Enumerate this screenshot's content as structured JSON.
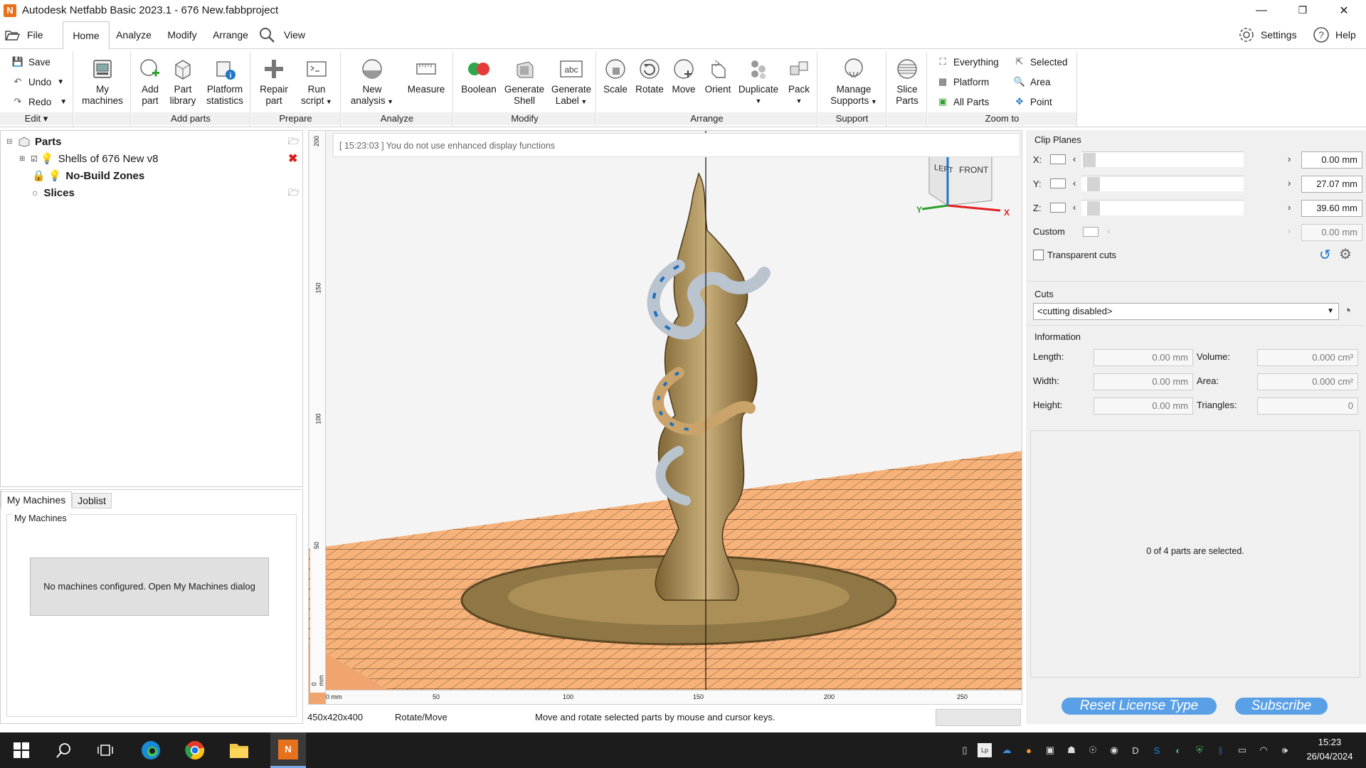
{
  "window": {
    "title": "Autodesk Netfabb Basic 2023.1 - 676 New.fabbproject",
    "app_icon_letter": "N",
    "minimize": "—",
    "restore": "❐",
    "close": "✕"
  },
  "menubar": {
    "file": "File",
    "tabs": [
      "Home",
      "Analyze",
      "Modify",
      "Arrange"
    ],
    "view": "View",
    "settings": "Settings",
    "help": "Help"
  },
  "ribbon": {
    "edit": {
      "save": "Save",
      "undo": "Undo",
      "redo": "Redo",
      "label": "Edit"
    },
    "my_machines": {
      "l1": "My",
      "l2": "machines"
    },
    "add_parts": {
      "add_part": {
        "l1": "Add",
        "l2": "part"
      },
      "part_library": {
        "l1": "Part",
        "l2": "library"
      },
      "platform_statistics": {
        "l1": "Platform",
        "l2": "statistics"
      },
      "label": "Add parts"
    },
    "prepare": {
      "repair_part": {
        "l1": "Repair",
        "l2": "part"
      },
      "run_script": {
        "l1": "Run",
        "l2": "script"
      },
      "label": "Prepare"
    },
    "analyze": {
      "new_analysis": {
        "l1": "New",
        "l2": "analysis"
      },
      "measure": "Measure",
      "label": "Analyze"
    },
    "modify": {
      "boolean": "Boolean",
      "generate_shell": {
        "l1": "Generate",
        "l2": "Shell"
      },
      "generate_label": {
        "l1": "Generate",
        "l2": "Label"
      },
      "label": "Modify"
    },
    "arrange": {
      "scale": "Scale",
      "rotate": "Rotate",
      "move": "Move",
      "orient": "Orient",
      "duplicate": "Duplicate",
      "pack": "Pack",
      "label": "Arrange"
    },
    "support": {
      "manage_supports": {
        "l1": "Manage",
        "l2": "Supports"
      },
      "label": "Support"
    },
    "slice": {
      "l1": "Slice",
      "l2": "Parts"
    },
    "zoom": {
      "everything": "Everything",
      "platform": "Platform",
      "all_parts": "All Parts",
      "selected": "Selected",
      "area": "Area",
      "point": "Point",
      "label": "Zoom to"
    }
  },
  "tree": {
    "parts": "Parts",
    "shells": "Shells of 676 New v8",
    "no_build": "No-Build Zones",
    "slices": "Slices"
  },
  "machines_panel": {
    "tabs": [
      "My Machines",
      "Joblist"
    ],
    "group": "My Machines",
    "message": "No machines configured. Open My Machines dialog"
  },
  "viewport": {
    "log": "[ 15:23:03 ] You do not use enhanced display functions",
    "cube_left": "LEFT",
    "cube_front": "FRONT",
    "axis_x": "X",
    "axis_y": "Y",
    "vruler": [
      "200",
      "150",
      "100",
      "50",
      "0 mm"
    ],
    "hruler": [
      "0 mm",
      "50",
      "100",
      "150",
      "200",
      "250"
    ]
  },
  "clip_planes": {
    "title": "Clip Planes",
    "x_label": "X:",
    "x_value": "0.00 mm",
    "y_label": "Y:",
    "y_value": "27.07 mm",
    "z_label": "Z:",
    "z_value": "39.60 mm",
    "custom_label": "Custom",
    "custom_value": "0.00 mm",
    "transparent_cuts": "Transparent cuts"
  },
  "cuts": {
    "title": "Cuts",
    "selected": "<cutting disabled>"
  },
  "information": {
    "title": "Information",
    "length_label": "Length:",
    "length": "0.00 mm",
    "width_label": "Width:",
    "width": "0.00 mm",
    "height_label": "Height:",
    "height": "0.00 mm",
    "volume_label": "Volume:",
    "volume": "0.000 cm³",
    "area_label": "Area:",
    "area": "0.000 cm²",
    "triangles_label": "Triangles:",
    "triangles": "0"
  },
  "selection_info": "0 of 4 parts are selected.",
  "buttons": {
    "reset_license": "Reset License Type",
    "subscribe": "Subscribe"
  },
  "status": {
    "dimensions": "450x420x400",
    "mode": "Rotate/Move",
    "hint": "Move and rotate selected parts by mouse and cursor keys."
  },
  "taskbar": {
    "time": "15:23",
    "date": "26/04/2024"
  },
  "colors": {
    "platform": "#f7b27a",
    "grid": "#3a2410",
    "model": "#b89a5e",
    "accent_blue": "#5aa0e6"
  }
}
